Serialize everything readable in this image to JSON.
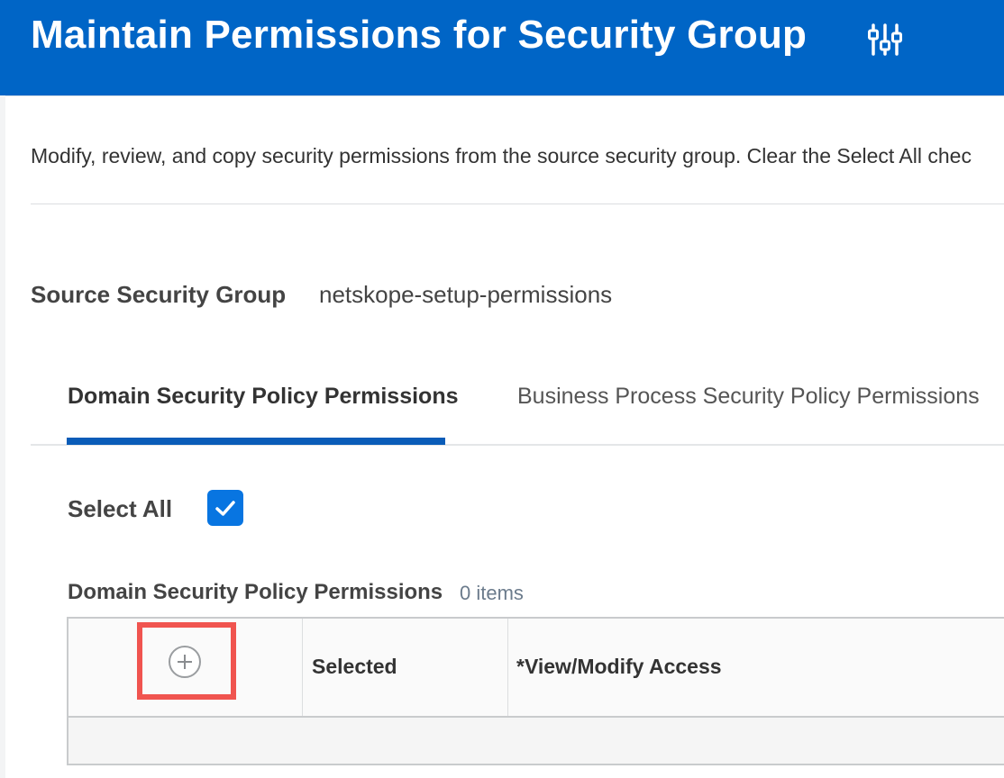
{
  "header": {
    "title": "Maintain Permissions for Security Group",
    "icon": "configure-sliders-icon",
    "background_color": "#0065c6"
  },
  "description": "Modify, review, and copy security permissions from the source security group. Clear the Select All chec",
  "source": {
    "label": "Source Security Group",
    "value": "netskope-setup-permissions"
  },
  "tabs": [
    {
      "label": "Domain Security Policy Permissions",
      "active": true
    },
    {
      "label": "Business Process Security Policy Permissions",
      "active": false
    }
  ],
  "select_all": {
    "label": "Select All",
    "checked": true,
    "color": "#0875e1"
  },
  "grid": {
    "title": "Domain Security Policy Permissions",
    "count": "0 items",
    "columns": [
      "Selected",
      "*View/Modify Access"
    ],
    "add_icon": "plus-circle-icon",
    "highlight_color": "#f0544f"
  }
}
